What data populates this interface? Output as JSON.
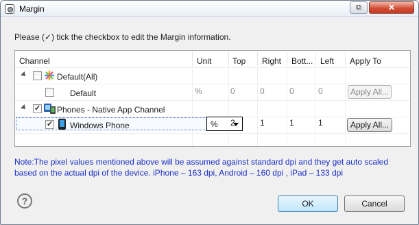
{
  "window": {
    "title": "Margin",
    "restore_glyph": "⧉",
    "close_glyph": "✕"
  },
  "instruction": "Please (✓) tick the checkbox to edit the Margin information.",
  "table": {
    "headers": [
      "Channel",
      "Unit",
      "Top",
      "Right",
      "Bott...",
      "Left",
      "Apply To"
    ],
    "rows": [
      {
        "label": "Default(All)",
        "checked": false,
        "expanded": true,
        "icon": "default-star-icon"
      },
      {
        "label": "Default",
        "checked": false,
        "unit": "%",
        "top": "0",
        "right": "0",
        "bottom": "0",
        "left": "0",
        "apply": "Apply All...",
        "enabled": false
      },
      {
        "label": "Phones - Native App Channel",
        "checked": true,
        "expanded": true,
        "icon": "phones-icon"
      },
      {
        "label": "Windows Phone",
        "checked": true,
        "unit": "%",
        "top": "2",
        "right": "1",
        "bottom": "1",
        "left": "1",
        "apply": "Apply All...",
        "enabled": true,
        "icon": "windows-phone-icon"
      }
    ]
  },
  "note": "Note:The pixel values mentioned above will be assumed against standard dpi and they get auto scaled based on the actual dpi of the device. iPhone – 163 dpi,  Android – 160 dpi , iPad – 133 dpi",
  "footer": {
    "help_glyph": "?",
    "ok_label": "OK",
    "cancel_label": "Cancel"
  },
  "colors": {
    "note_text": "#1a2fc8",
    "selection_border": "#3d6fd1",
    "close_button": "#c43a22"
  }
}
